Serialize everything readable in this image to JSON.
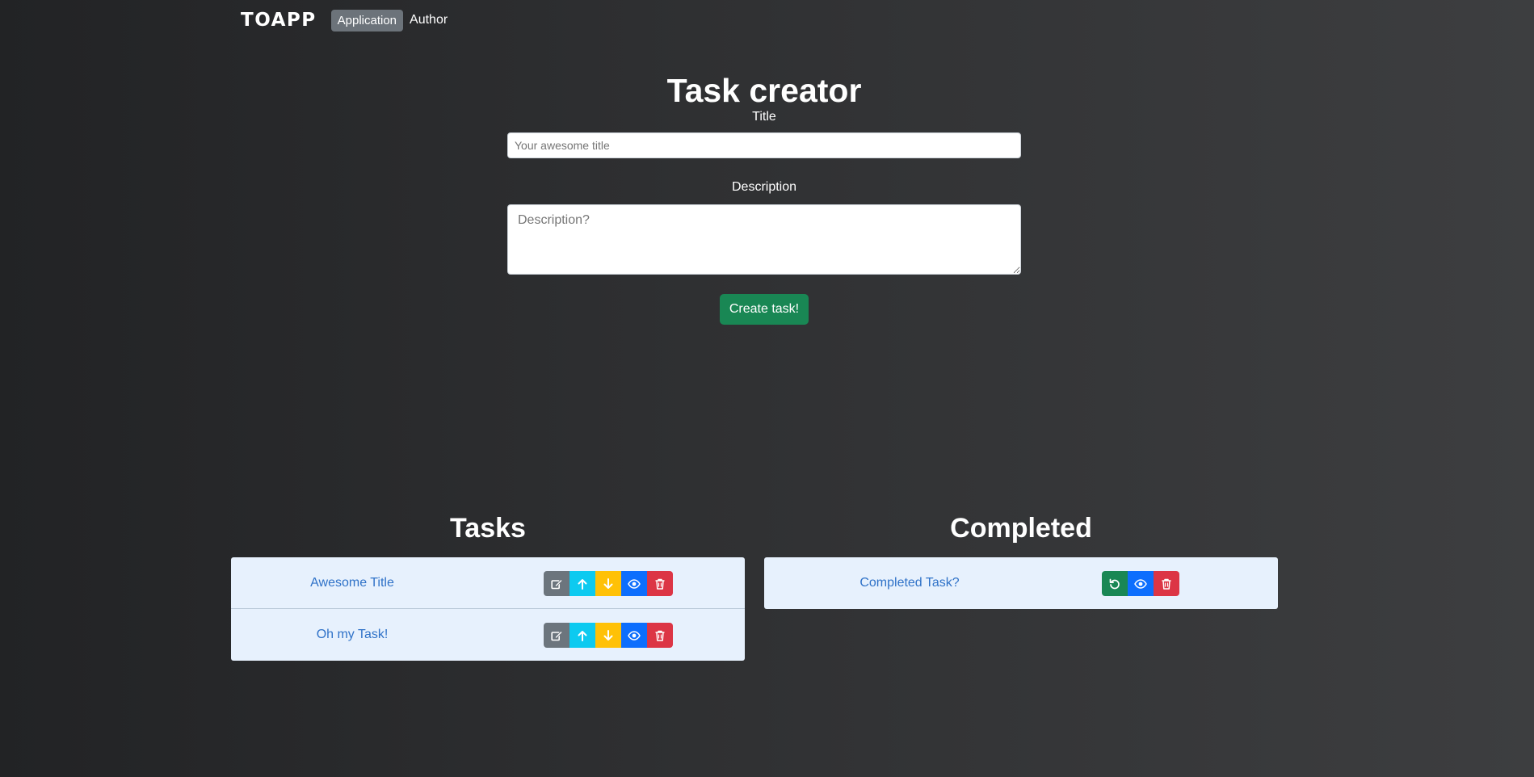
{
  "nav": {
    "brand": "TOAPP",
    "links": [
      {
        "label": "Application",
        "active": true
      },
      {
        "label": "Author",
        "active": false
      }
    ]
  },
  "creator": {
    "heading": "Task creator",
    "title_label": "Title",
    "title_placeholder": "Your awesome title",
    "description_label": "Description",
    "description_placeholder": "Description?",
    "create_label": "Create task!"
  },
  "tasks": {
    "heading": "Tasks",
    "items": [
      {
        "title": "Awesome Title",
        "actions": [
          "edit-icon",
          "arrow-up-icon",
          "arrow-down-icon",
          "eye-icon",
          "trash-icon"
        ]
      },
      {
        "title": "Oh my Task!",
        "actions": [
          "edit-icon",
          "arrow-up-icon",
          "arrow-down-icon",
          "eye-icon",
          "trash-icon"
        ]
      }
    ]
  },
  "completed": {
    "heading": "Completed",
    "items": [
      {
        "title": "Completed Task?",
        "actions": [
          "undo-icon",
          "eye-icon",
          "trash-icon"
        ]
      }
    ]
  },
  "colors": {
    "edit": "#6c757d",
    "up": "#0dcaf0",
    "down": "#ffc107",
    "view": "#0d6efd",
    "delete": "#dc3545",
    "restore": "#198754",
    "create": "#198754",
    "list_bg": "#e7f1fd",
    "link": "#2f72c8"
  }
}
